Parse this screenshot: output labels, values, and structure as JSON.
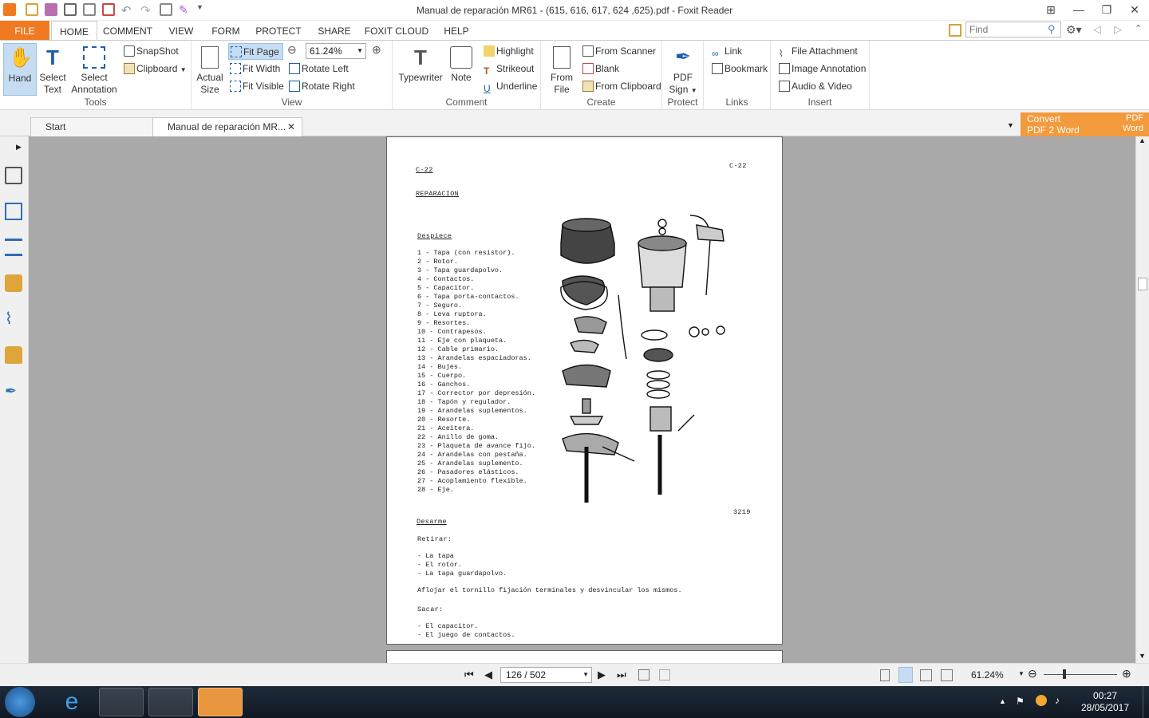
{
  "window": {
    "title": "Manual de reparación MR61 - (615, 616, 617, 624 ,625).pdf - Foxit Reader"
  },
  "tabs": [
    "FILE",
    "HOME",
    "COMMENT",
    "VIEW",
    "FORM",
    "PROTECT",
    "SHARE",
    "FOXIT CLOUD",
    "HELP"
  ],
  "search": {
    "placeholder": "Find"
  },
  "ribbon": {
    "tools": {
      "label": "Tools",
      "hand": "Hand",
      "select_text_1": "Select",
      "select_text_2": "Text",
      "select_ann_1": "Select",
      "select_ann_2": "Annotation",
      "snapshot": "SnapShot",
      "clipboard": "Clipboard"
    },
    "view": {
      "label": "View",
      "actual_1": "Actual",
      "actual_2": "Size",
      "fit_page": "Fit Page",
      "fit_width": "Fit Width",
      "fit_visible": "Fit Visible",
      "zoom": "61.24%",
      "rotate_left": "Rotate Left",
      "rotate_right": "Rotate Right"
    },
    "comment": {
      "label": "Comment",
      "typewriter": "Typewriter",
      "note": "Note",
      "highlight": "Highlight",
      "strikeout": "Strikeout",
      "underline": "Underline"
    },
    "create": {
      "label": "Create",
      "from_file_1": "From",
      "from_file_2": "File",
      "from_scanner": "From Scanner",
      "blank": "Blank",
      "from_clipboard": "From Clipboard"
    },
    "protect": {
      "label": "Protect",
      "pdf_sign_1": "PDF",
      "pdf_sign_2": "Sign"
    },
    "links": {
      "label": "Links",
      "link": "Link",
      "bookmark": "Bookmark"
    },
    "insert": {
      "label": "Insert",
      "file_attachment": "File Attachment",
      "image_annotation": "Image Annotation",
      "audio_video": "Audio & Video"
    }
  },
  "doc_tabs": {
    "start": "Start",
    "current": "Manual de reparación MR..."
  },
  "convert": {
    "line1": "Convert",
    "line2": "PDF 2 Word",
    "badge1": "PDF",
    "badge2": "Word"
  },
  "page": {
    "header_left": "C-22",
    "header_right": "C-22",
    "section": "REPARACION",
    "subsection": "Despiece",
    "parts": [
      "1  - Tapa (con resistor).",
      "2  - Rotor.",
      "3  - Tapa guardapolvo.",
      "4  - Contactos.",
      "5  - Capacitor.",
      "6  - Tapa porta-contactos.",
      "7  - Seguro.",
      "8  - Leva ruptora.",
      "9  - Resortes.",
      "10 - Contrapesos.",
      "11 - Eje con plaqueta.",
      "12 - Cable primario.",
      "13 - Arandelas espaciadoras.",
      "14 - Bujes.",
      "15 - Cuerpo.",
      "16 - Ganchos.",
      "17 - Corrector por depresión.",
      "18 - Tapón y regulador.",
      "19 - Arandelas suplementos.",
      "20 - Resorte.",
      "21 - Aceitera.",
      "22 - Anillo de goma.",
      "23 - Plaqueta de avance fijo.",
      "24 - Arandelas con pestaña.",
      "25 - Arandelas suplemento.",
      "26 - Pasadores elásticos.",
      "27 - Acoplamiento flexible.",
      "28 - Eje."
    ],
    "figure_number": "3219",
    "desarme": "Desarme",
    "retirar": "Retirar:",
    "retirar_items": [
      "- La tapa",
      "- El rotor.",
      "- La tapa guardapolvo."
    ],
    "aflojar": "Aflojar el tornillo fijación terminales y desvincular los mismos.",
    "sacar": "Sacar:",
    "sacar_items": [
      "- El capacitor.",
      "- El juego de contactos."
    ]
  },
  "status": {
    "page": "126 / 502",
    "zoom": "61.24%"
  },
  "taskbar": {
    "time": "00:27",
    "date": "28/05/2017"
  },
  "colors": {
    "accent": "#f07a22",
    "convert": "#f39a3c"
  }
}
